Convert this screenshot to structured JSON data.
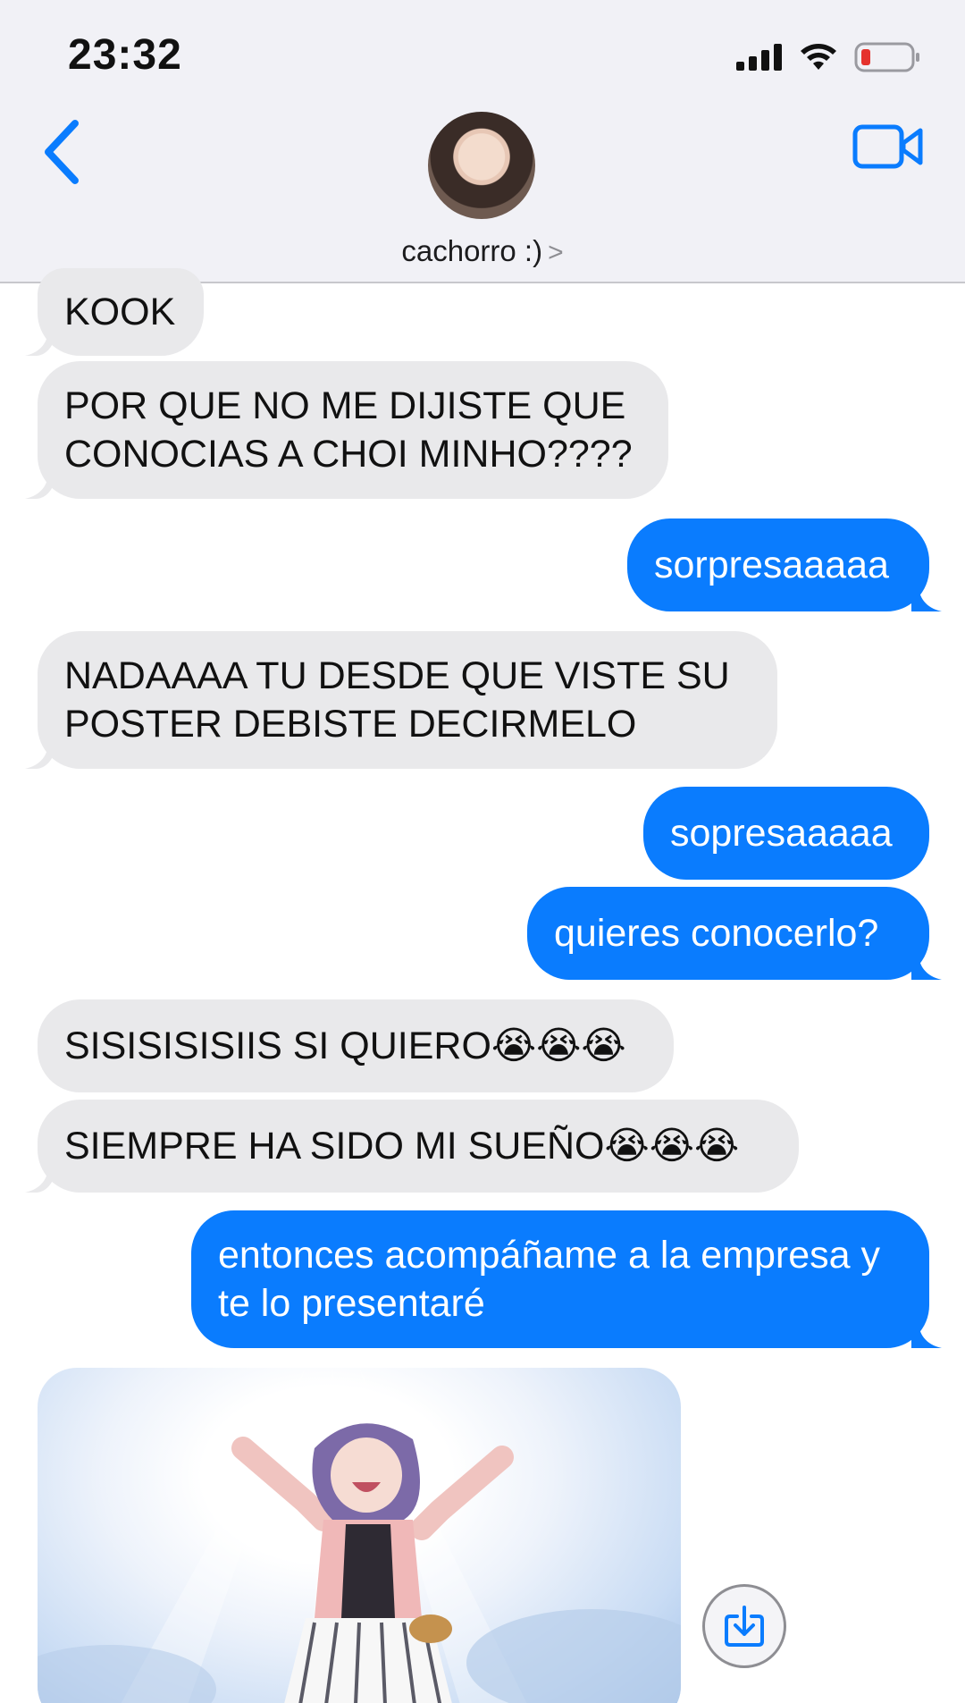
{
  "status_bar": {
    "time": "23:32",
    "icons": [
      "signal-icon",
      "wifi-icon",
      "battery-low-icon"
    ],
    "battery_color": "#e5322d"
  },
  "header": {
    "contact_name": "cachorro :)",
    "chevron": ">",
    "back_icon": "chevron-left-icon",
    "video_icon": "video-camera-icon"
  },
  "messages": [
    {
      "side": "received",
      "text": "KOOK"
    },
    {
      "side": "received",
      "text": "POR QUE NO ME DIJISTE QUE CONOCIAS A CHOI MINHO????"
    },
    {
      "side": "sent",
      "text": "sorpresaaaaa"
    },
    {
      "side": "received",
      "text": "NADAAAA TU DESDE QUE VISTE SU POSTER DEBISTE DECIRMELO"
    },
    {
      "side": "sent",
      "text": "sopresaaaaa"
    },
    {
      "side": "sent",
      "text": "quieres conocerlo?"
    },
    {
      "side": "received",
      "text": "SISISISISIIS SI QUIERO😭😭😭"
    },
    {
      "side": "received",
      "text": "SIEMPRE HA SIDO MI SUEÑO😭😭😭"
    },
    {
      "side": "sent",
      "text": "entonces acompáñame a la empresa y te lo presentaré"
    },
    {
      "side": "received",
      "type": "image",
      "description": "anime-girl-celebrating-image"
    }
  ],
  "colors": {
    "sent_bubble": "#0a7cfe",
    "received_bubble": "#e9e9eb",
    "accent": "#0a7cfe"
  },
  "save_icon": "save-download-icon"
}
